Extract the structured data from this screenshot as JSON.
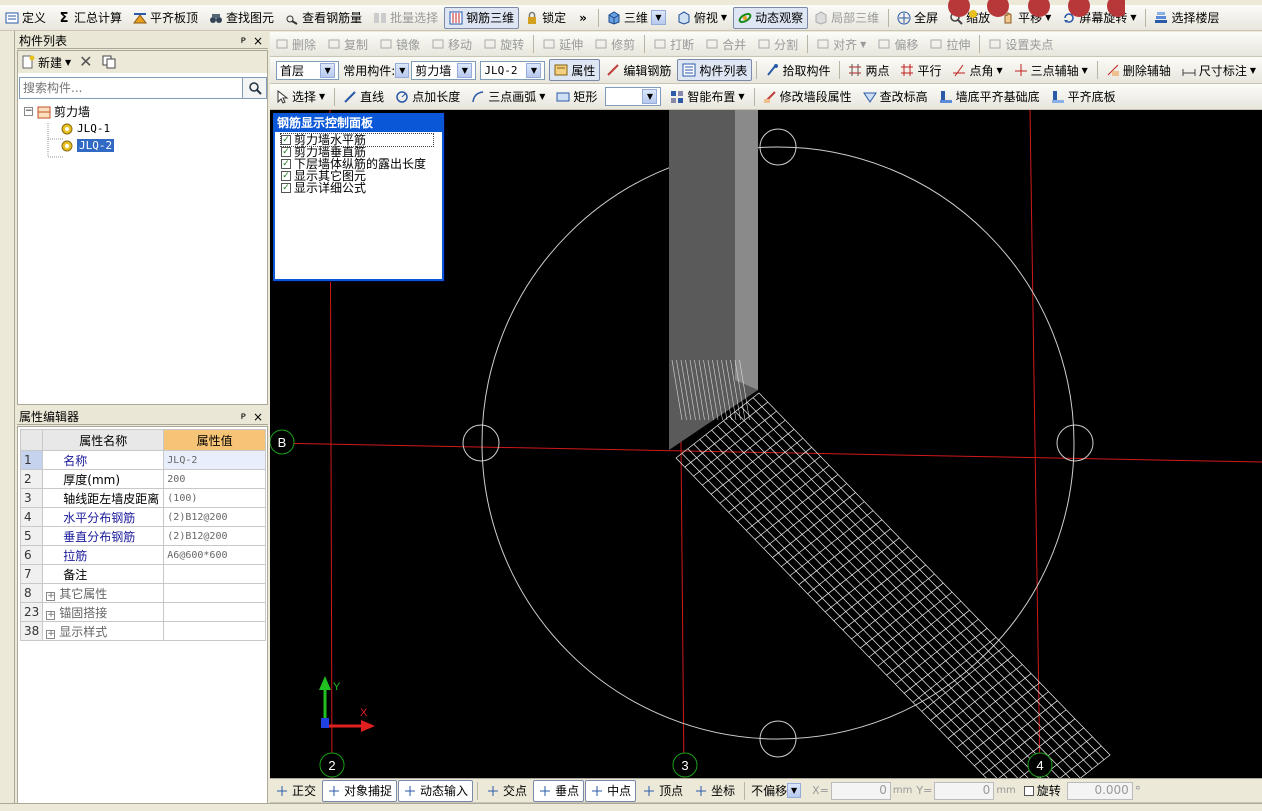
{
  "toolbar1": {
    "items": [
      {
        "label": "定义",
        "icon": "define-icon"
      },
      {
        "label": "汇总计算",
        "icon": "sigma-icon"
      },
      {
        "label": "平齐板顶",
        "icon": "align-slab-icon"
      },
      {
        "label": "查找图元",
        "icon": "binoculars-icon"
      },
      {
        "label": "查看钢筋量",
        "icon": "view-rebar-icon"
      },
      {
        "label": "批量选择",
        "icon": "batch-select-icon"
      },
      {
        "label": "钢筋三维",
        "icon": "rebar-3d-icon"
      },
      {
        "label": "锁定",
        "icon": "lock-icon"
      },
      {
        "label": "三维",
        "icon": "cube-icon"
      },
      {
        "label": "俯视",
        "icon": "top-view-icon"
      },
      {
        "label": "动态观察",
        "icon": "orbit-icon"
      },
      {
        "label": "局部三维",
        "icon": "local-3d-icon"
      },
      {
        "label": "全屏",
        "icon": "fullscreen-icon"
      },
      {
        "label": "缩放",
        "icon": "zoom-icon"
      },
      {
        "label": "平移",
        "icon": "pan-icon"
      },
      {
        "label": "屏幕旋转",
        "icon": "rotate-screen-icon"
      },
      {
        "label": "选择楼层",
        "icon": "floor-select-icon"
      }
    ],
    "more": "»"
  },
  "toolbar2": {
    "items": [
      "删除",
      "复制",
      "镜像",
      "移动",
      "旋转",
      "延伸",
      "修剪",
      "打断",
      "合并",
      "分割",
      "对齐",
      "偏移",
      "拉伸",
      "设置夹点"
    ]
  },
  "toolbar3": {
    "floor": "首层",
    "category_label": "常用构件:",
    "category": "剪力墙",
    "component": "JLQ-2",
    "items": [
      "属性",
      "编辑钢筋",
      "构件列表",
      "拾取构件",
      "两点",
      "平行",
      "点角",
      "三点辅轴",
      "删除辅轴",
      "尺寸标注"
    ]
  },
  "toolbar4": {
    "items": [
      "选择",
      "直线",
      "点加长度",
      "三点画弧",
      "矩形",
      "智能布置",
      "修改墙段属性",
      "查改标高",
      "墙底平齐基础底",
      "平齐底板"
    ],
    "arc_value": ""
  },
  "component_panel": {
    "title": "构件列表",
    "pin": "ᴘ",
    "close": "×",
    "new_label": "新建",
    "search_placeholder": "搜索构件...",
    "tree": {
      "root": "剪力墙",
      "children": [
        "JLQ-1",
        "JLQ-2"
      ],
      "selected": "JLQ-2"
    }
  },
  "property_panel": {
    "title": "属性编辑器",
    "col_name": "属性名称",
    "col_value": "属性值",
    "rows": [
      {
        "num": "1",
        "name": "名称",
        "value": "JLQ-2",
        "blue": true,
        "expand": false
      },
      {
        "num": "2",
        "name": "厚度(mm)",
        "value": "200",
        "blue": false,
        "expand": false
      },
      {
        "num": "3",
        "name": "轴线距左墙皮距离",
        "value": "(100)",
        "blue": false,
        "expand": false
      },
      {
        "num": "4",
        "name": "水平分布钢筋",
        "value": "(2)B12@200",
        "blue": true,
        "expand": false
      },
      {
        "num": "5",
        "name": "垂直分布钢筋",
        "value": "(2)B12@200",
        "blue": true,
        "expand": false
      },
      {
        "num": "6",
        "name": "拉筋",
        "value": "A6@600*600",
        "blue": true,
        "expand": false
      },
      {
        "num": "7",
        "name": "备注",
        "value": "",
        "blue": false,
        "expand": false
      },
      {
        "num": "8",
        "name": "其它属性",
        "value": "",
        "blue": false,
        "expand": true
      },
      {
        "num": "23",
        "name": "锚固搭接",
        "value": "",
        "blue": false,
        "expand": true
      },
      {
        "num": "38",
        "name": "显示样式",
        "value": "",
        "blue": false,
        "expand": true
      }
    ]
  },
  "rebar_panel": {
    "title": "钢筋显示控制面板",
    "options": [
      "剪力墙水平筋",
      "剪力墙垂直筋",
      "下层墙体纵筋的露出长度",
      "显示其它图元",
      "显示详细公式"
    ]
  },
  "canvas": {
    "axis_labels": [
      "B",
      "2",
      "3",
      "4"
    ],
    "ucs_y": "Y",
    "ucs_x": "X"
  },
  "statusbar": {
    "items": [
      "正交",
      "对象捕捉",
      "动态输入",
      "交点",
      "垂点",
      "中点",
      "顶点",
      "坐标"
    ],
    "offset_mode": "不偏移",
    "x_label": "X=",
    "x_value": "0",
    "y_label": "Y=",
    "y_value": "0",
    "unit": "mm",
    "rotate_label": "旋转",
    "rotate_value": "0.000",
    "degree": "°"
  },
  "colors": {
    "canvas_bg": "#000000",
    "axis_red": "#d01818",
    "axis_bubble": "#1aa01a",
    "rebar_white": "#ffffff",
    "panel_title_blue": "#0a58d8"
  }
}
